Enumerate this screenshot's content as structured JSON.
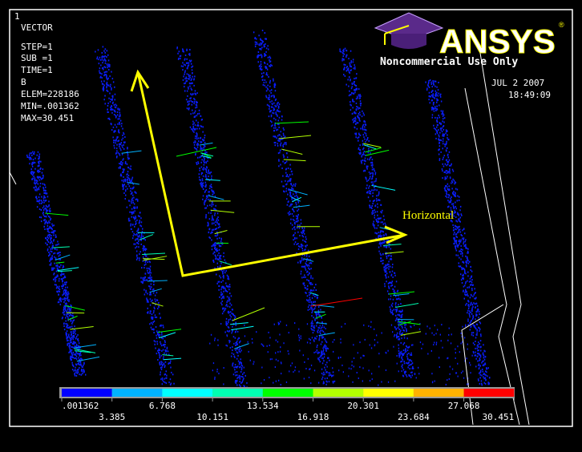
{
  "window_number": "1",
  "info": {
    "title": "VECTOR",
    "step": "STEP=1",
    "sub": "SUB =1",
    "time": "TIME=1",
    "quantity": "B",
    "elem": "ELEM=228186",
    "min": "MIN=.001362",
    "max": "MAX=30.451"
  },
  "logo": {
    "brand": "ANSYS",
    "registered": "®",
    "notice": "Noncommercial Use Only"
  },
  "date": "JUL  2 2007",
  "time": "18:49:09",
  "annotation": "Horizontal",
  "legend": {
    "colors": [
      "#0000FF",
      "#00B2FF",
      "#00FFFF",
      "#00FFB2",
      "#00FF00",
      "#B2FF00",
      "#FFFF00",
      "#FFB200",
      "#FF0000"
    ],
    "top_labels": [
      ".001362",
      "6.768",
      "13.534",
      "20.301",
      "27.068"
    ],
    "bottom_labels": [
      "3.385",
      "10.151",
      "16.918",
      "23.684",
      "30.451"
    ]
  }
}
